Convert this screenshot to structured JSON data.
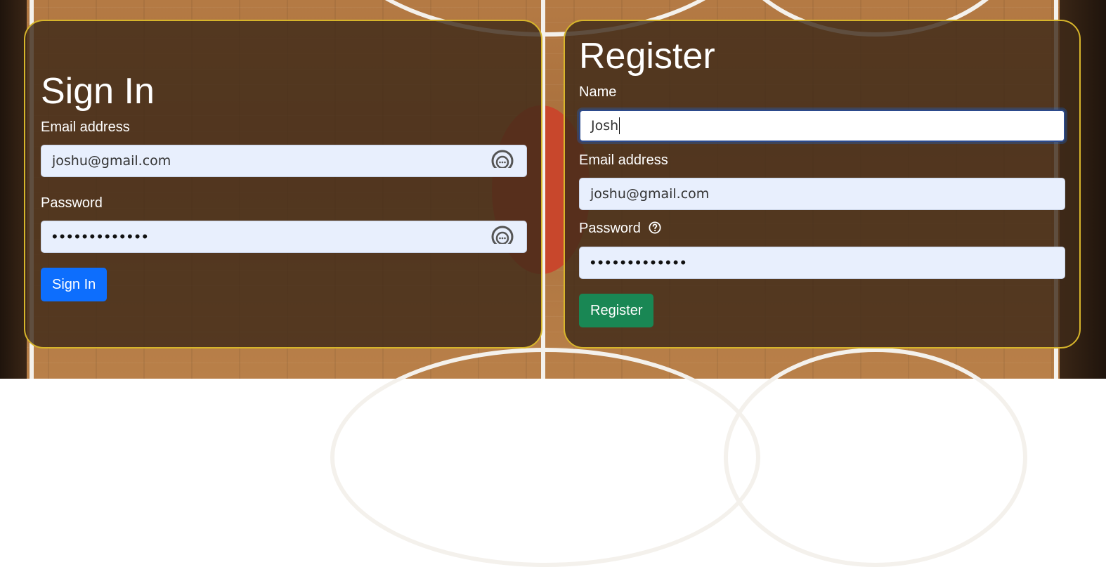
{
  "signin": {
    "title": "Sign In",
    "email_label": "Email address",
    "email_value": "joshu@gmail.com",
    "password_label": "Password",
    "password_value": "•••••••••••••",
    "button_label": "Sign In"
  },
  "register": {
    "title": "Register",
    "name_label": "Name",
    "name_value": "Josh",
    "email_label": "Email address",
    "email_value": "joshu@gmail.com",
    "password_label": "Password",
    "password_value": "•••••••••••••",
    "button_label": "Register"
  },
  "icons": {
    "password_manager": "password-manager-icon",
    "help": "question-circle-icon"
  },
  "colors": {
    "primary": "#0d6efd",
    "success": "#198754",
    "panel_border": "#d7b52b",
    "input_bg": "#e8effd"
  }
}
